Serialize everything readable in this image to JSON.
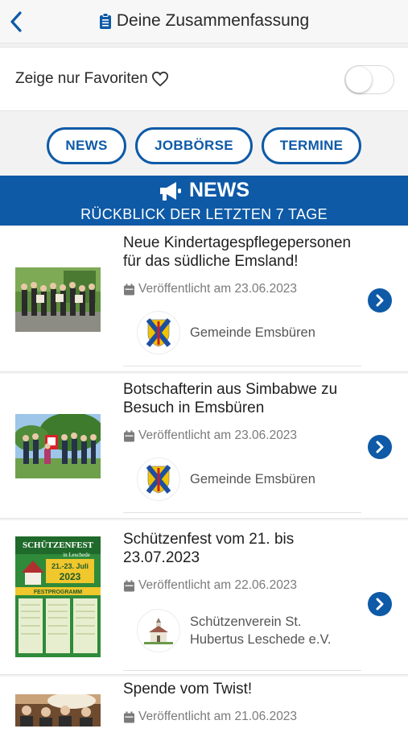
{
  "header": {
    "title": "Deine Zusammenfassung"
  },
  "favorites": {
    "label": "Zeige nur Favoriten",
    "enabled": false
  },
  "tabs": [
    {
      "label": "NEWS"
    },
    {
      "label": "JOBBÖRSE"
    },
    {
      "label": "TERMINE"
    }
  ],
  "banner": {
    "title": "NEWS",
    "subtitle": "RÜCKBLICK DER LETZTEN 7 TAGE"
  },
  "news": [
    {
      "title_line1": "Neue Kindertagespflegepersonen",
      "title_line2": "für das südliche Emsland!",
      "date": "Veröffentlicht am 23.06.2023",
      "source_line1": "Gemeinde Emsbüren",
      "source_line2": ""
    },
    {
      "title_line1": "Botschafterin aus Simbabwe zu",
      "title_line2": "Besuch in Emsbüren",
      "date": "Veröffentlicht am 23.06.2023",
      "source_line1": "Gemeinde Emsbüren",
      "source_line2": ""
    },
    {
      "title_line1": "Schützenfest vom 21. bis",
      "title_line2": "23.07.2023",
      "date": "Veröffentlicht am 22.06.2023",
      "source_line1": "Schützenverein St.",
      "source_line2": "Hubertus Leschede e.V."
    },
    {
      "title_line1": "Spende vom Twist!",
      "title_line2": "",
      "date": "Veröffentlicht am 21.06.2023",
      "source_line1": "",
      "source_line2": ""
    }
  ],
  "poster": {
    "heading": "SCHÜTZENFEST",
    "subheading": "in Leschede",
    "dates": "21.-23. Juli",
    "year": "2023",
    "program": "FESTPROGRAMM"
  },
  "colors": {
    "accent": "#0e5aa7",
    "crest_yellow": "#f2c200",
    "crest_blue": "#1d4fa0",
    "crest_red": "#c8202a"
  },
  "icons": [
    "back-chevron-icon",
    "clipboard-icon",
    "heart-outline-icon",
    "megaphone-icon",
    "calendar-icon",
    "chevron-right-circle-icon"
  ]
}
